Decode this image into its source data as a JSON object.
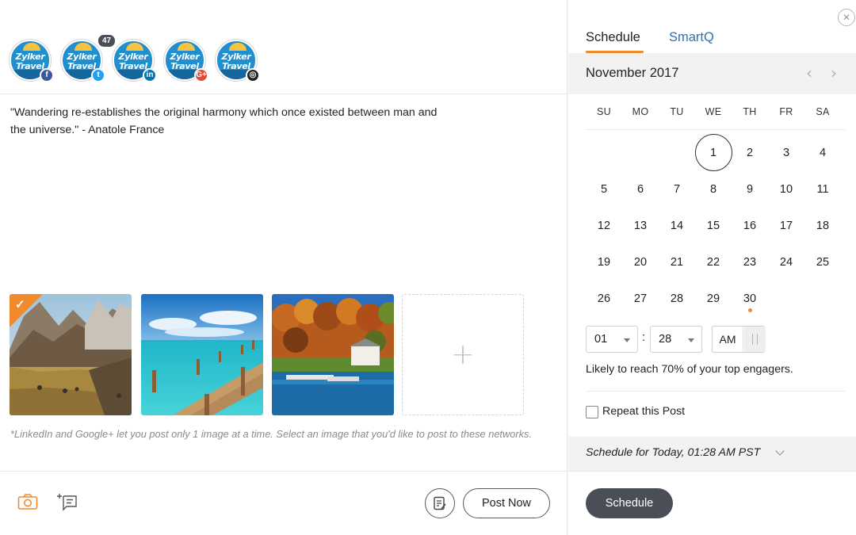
{
  "profiles": [
    {
      "brand": "Zylker Travel",
      "logo_text_line1": "Zylker",
      "logo_text_line2": "Travel",
      "network": "Facebook",
      "network_glyph": "f",
      "network_color": "#3b5998",
      "network_icon": "facebook-icon"
    },
    {
      "brand": "Zylker Travel",
      "logo_text_line1": "Zylker",
      "logo_text_line2": "Travel",
      "network": "Twitter",
      "network_glyph": "t",
      "network_color": "#1da1f2",
      "network_icon": "twitter-icon",
      "badge": "47"
    },
    {
      "brand": "Zylker Travel",
      "logo_text_line1": "Zylker",
      "logo_text_line2": "Travel",
      "network": "LinkedIn",
      "network_glyph": "in",
      "network_color": "#0077b5",
      "network_icon": "linkedin-icon"
    },
    {
      "brand": "Zylker Travel",
      "logo_text_line1": "Zylker",
      "logo_text_line2": "Travel",
      "network": "Google+",
      "network_glyph": "G+",
      "network_color": "#dd4b39",
      "network_icon": "google-plus-icon"
    },
    {
      "brand": "Zylker Travel",
      "logo_text_line1": "Zylker",
      "logo_text_line2": "Travel",
      "network": "Instagram",
      "network_glyph": "◎",
      "network_color": "#222222",
      "network_icon": "instagram-icon"
    }
  ],
  "composer": {
    "text": "\"Wandering re-establishes the original harmony which once existed between man and the universe.\" - Anatole France"
  },
  "images": [
    {
      "name": "mountain-valley-image",
      "selected": true
    },
    {
      "name": "pier-ocean-image",
      "selected": false
    },
    {
      "name": "lake-house-autumn-image",
      "selected": false
    }
  ],
  "add_image_label": "+",
  "image_note": "*LinkedIn and Google+ let you post only 1 image at a time. Select an image that you'd like to post to these networks.",
  "footer": {
    "post_now_label": "Post Now"
  },
  "schedule_panel": {
    "tabs": [
      {
        "label": "Schedule",
        "active": true
      },
      {
        "label": "SmartQ",
        "active": false
      }
    ],
    "month_title": "November 2017",
    "weekdays": [
      "SU",
      "MO",
      "TU",
      "WE",
      "TH",
      "FR",
      "SA"
    ],
    "first_weekday_index": 3,
    "days_in_month": 30,
    "today": 1,
    "suggested_day": 30,
    "hour": "01",
    "minute": "28",
    "meridiem": "AM",
    "reach_text": "Likely to reach 70% of your top engagers.",
    "repeat_label": "Repeat this Post",
    "repeat_checked": false,
    "schedule_summary": "Schedule for Today, 01:28 AM PST",
    "schedule_button_label": "Schedule"
  },
  "colors": {
    "accent": "#f08a2c",
    "link": "#2e6fb7",
    "dark_button": "#4a4f57",
    "brand_blue": "#1f8fd0"
  }
}
